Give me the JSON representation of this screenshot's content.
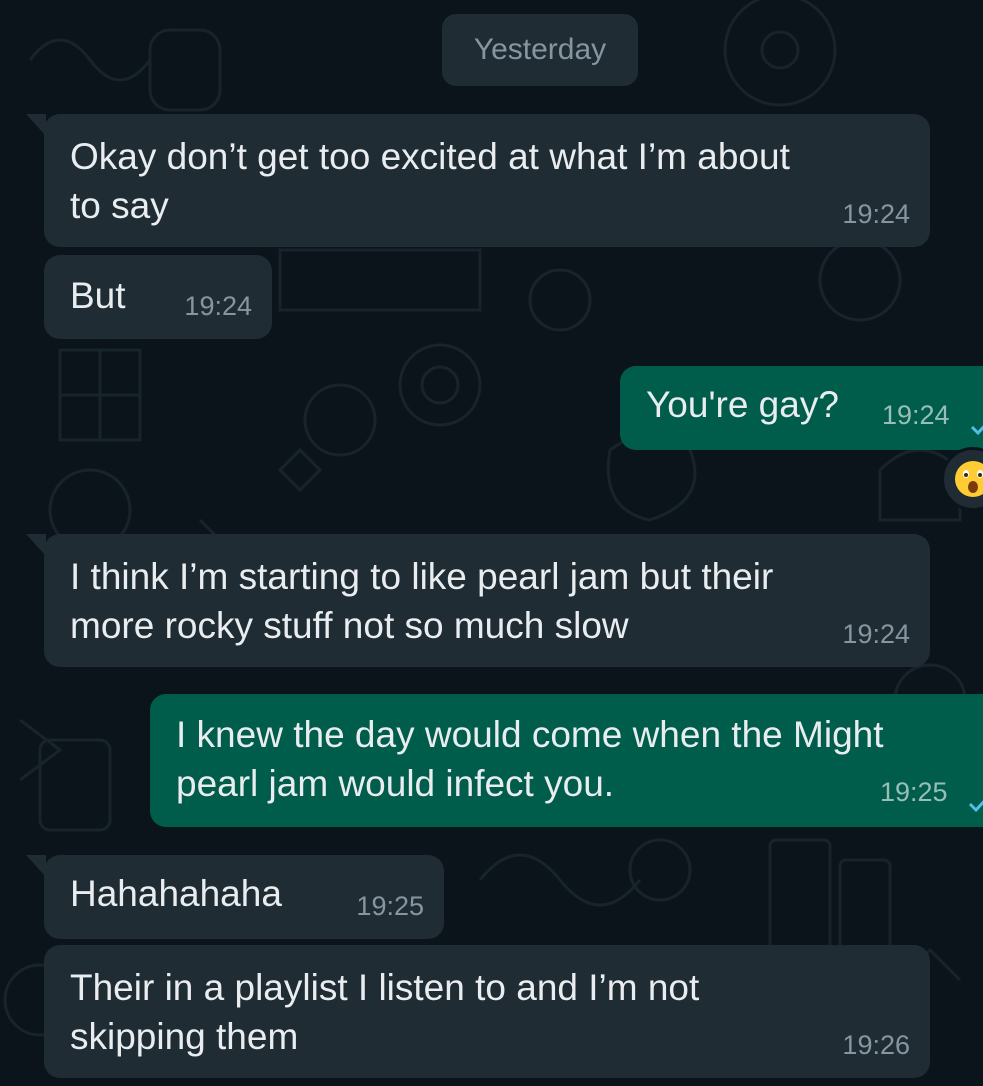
{
  "date_separator": "Yesterday",
  "messages": [
    {
      "direction": "incoming",
      "text": "Okay don’t get too excited at what I’m about\nto say",
      "time": "19:24"
    },
    {
      "direction": "incoming",
      "text": "But",
      "time": "19:24"
    },
    {
      "direction": "outgoing",
      "text": "You're gay?",
      "time": "19:24",
      "status": "sent-tick-icon",
      "reaction": "astonished-face-emoji"
    },
    {
      "direction": "incoming",
      "text": "I think I’m starting to like pearl jam but their\nmore rocky stuff not so much slow",
      "time": "19:24"
    },
    {
      "direction": "outgoing",
      "text": "I knew the day would come when the Might\npearl jam would infect you.",
      "time": "19:25",
      "status": "sent-tick-icon"
    },
    {
      "direction": "incoming",
      "text": "Hahahahaha",
      "time": "19:25"
    },
    {
      "direction": "incoming",
      "text": "Their in a playlist I listen to and I’m not\nskipping them",
      "time": "19:26"
    }
  ],
  "colors": {
    "background": "#0b141a",
    "incoming_bubble": "#1f2c34",
    "outgoing_bubble": "#005c4b",
    "text": "#e9edef",
    "meta": "#8696a0"
  }
}
